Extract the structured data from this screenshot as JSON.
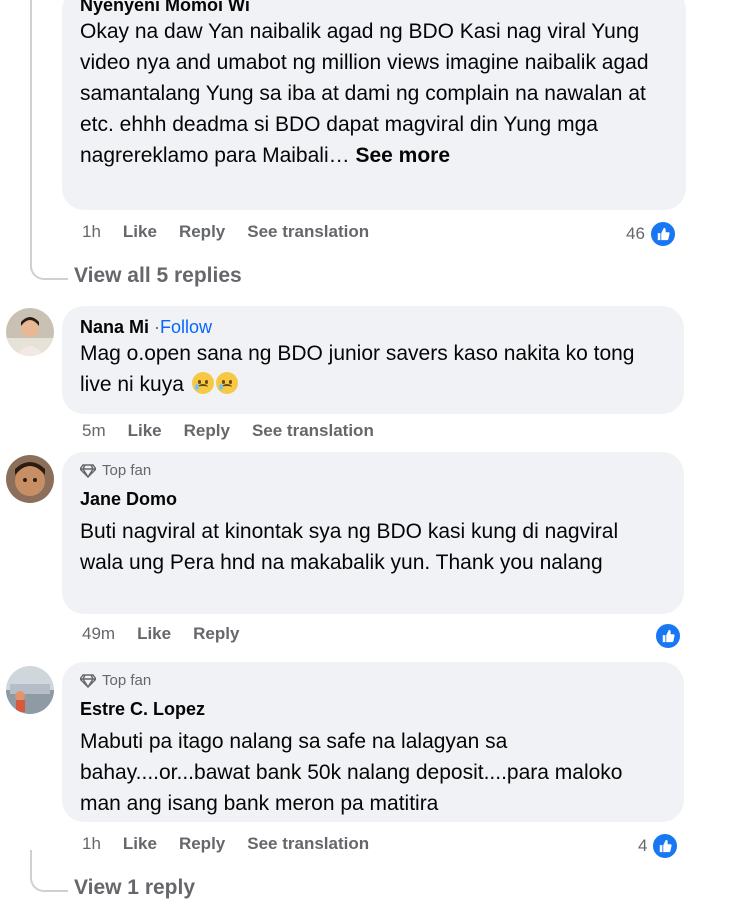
{
  "comments": [
    {
      "author": "Nyenyeni Momoi Wi",
      "text": "Okay na daw Yan naibalik agad ng BDO Kasi nag viral Yung video nya and umabot ng million views imagine naibalik agad samantalang Yung sa iba at dami ng complain na nawalan at etc. ehhh deadma si BDO dapat magviral din Yung mga nagrereklamo para Maibali…",
      "see_more": "See more",
      "time": "1h",
      "like": "Like",
      "reply": "Reply",
      "translate": "See translation",
      "reactions": "46"
    },
    {
      "author": "Nana Mi",
      "follow": "Follow",
      "text": "Mag o.open sana ng BDO junior savers kaso nakita ko tong live ni kuya",
      "time": "5m",
      "like": "Like",
      "reply": "Reply",
      "translate": "See translation"
    },
    {
      "badge": "Top fan",
      "author": "Jane Domo",
      "text": "Buti nagviral at kinontak sya ng BDO kasi kung di nagviral wala ung Pera hnd na makabalik yun. Thank you nalang",
      "time": "49m",
      "like": "Like",
      "reply": "Reply"
    },
    {
      "badge": "Top fan",
      "author": "Estre C. Lopez",
      "text": "Mabuti pa itago nalang sa safe na lalagyan sa bahay....or...bawat bank 50k nalang deposit....para maloko man ang isang bank meron pa matitira",
      "time": "1h",
      "like": "Like",
      "reply": "Reply",
      "translate": "See translation",
      "reactions": "4"
    }
  ],
  "view_all_replies": "View all 5 replies",
  "view_reply": "View 1 reply",
  "icons": {
    "reaction": "like-icon",
    "badge": "diamond-icon"
  },
  "colors": {
    "accent": "#0866ff",
    "like_badge": "#1877f2",
    "bubble": "#f0f2f5",
    "muted": "#65676b"
  }
}
